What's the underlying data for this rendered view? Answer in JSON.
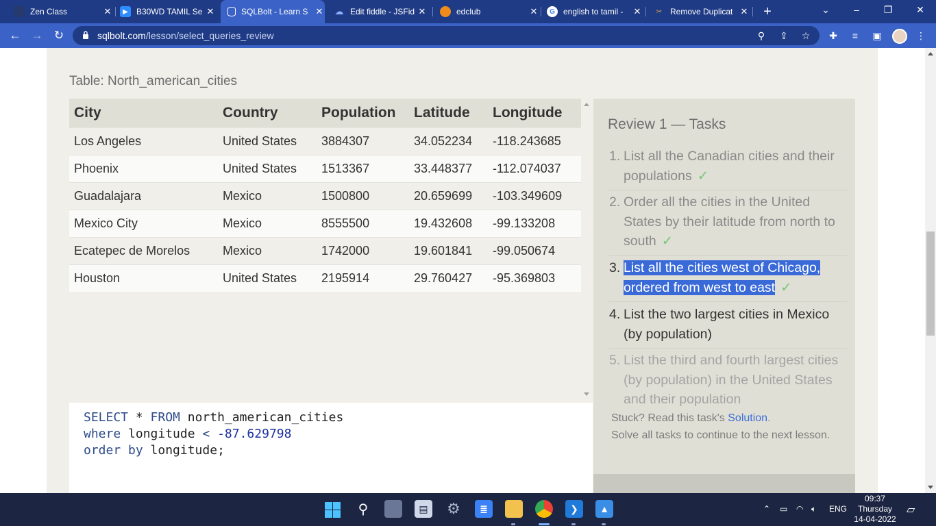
{
  "browser": {
    "tabs": [
      {
        "title": "Zen Class",
        "active": false
      },
      {
        "title": "B30WD TAMIL Se",
        "active": false
      },
      {
        "title": "SQLBolt - Learn S",
        "active": true
      },
      {
        "title": "Edit fiddle - JSFid",
        "active": false
      },
      {
        "title": "edclub",
        "active": false
      },
      {
        "title": "english to tamil -",
        "active": false
      },
      {
        "title": "Remove Duplicat",
        "active": false
      }
    ],
    "url_host": "sqlbolt.com",
    "url_path": "/lesson/select_queries_review"
  },
  "lesson": {
    "table_caption": "Table: North_american_cities",
    "columns": [
      "City",
      "Country",
      "Population",
      "Latitude",
      "Longitude"
    ],
    "rows": [
      [
        "Los Angeles",
        "United States",
        "3884307",
        "34.052234",
        "-118.243685"
      ],
      [
        "Phoenix",
        "United States",
        "1513367",
        "33.448377",
        "-112.074037"
      ],
      [
        "Guadalajara",
        "Mexico",
        "1500800",
        "20.659699",
        "-103.349609"
      ],
      [
        "Mexico City",
        "Mexico",
        "8555500",
        "19.432608",
        "-99.133208"
      ],
      [
        "Ecatepec de Morelos",
        "Mexico",
        "1742000",
        "19.601841",
        "-99.050674"
      ],
      [
        "Houston",
        "United States",
        "2195914",
        "29.760427",
        "-95.369803"
      ]
    ],
    "query": {
      "line1_kw1": "SELECT",
      "line1_star": " * ",
      "line1_kw2": "FROM",
      "line1_table": " north_american_cities",
      "line2_kw": "where",
      "line2_col": " longitude ",
      "line2_op": "<",
      "line2_val": " -87.629798",
      "line3_kw": "order by",
      "line3_col": " longitude;"
    }
  },
  "tasks": {
    "heading": "Review 1 — Tasks",
    "items": [
      {
        "num": "1.",
        "text": "List all the Canadian cities and their populations",
        "done": true
      },
      {
        "num": "2.",
        "text": "Order all the cities in the United States by their latitude from north to south",
        "done": true
      },
      {
        "num": "3.",
        "text_line1": "List all the cities west of Chicago,",
        "text_line2": "ordered from west to east",
        "done": true
      },
      {
        "num": "4.",
        "text": "List the two largest cities in Mexico (by population)",
        "done": false
      },
      {
        "num": "5.",
        "text": "List the third and fourth largest cities (by population) in the United States and their population",
        "done": false
      }
    ],
    "check_mark": "✓",
    "stuck_prefix": "Stuck? Read this task's ",
    "solution_link": "Solution",
    "stuck_suffix": ".",
    "continue_text": "Solve all tasks to continue to the next lesson."
  },
  "system": {
    "time": "09:37",
    "day": "Thursday",
    "date": "14-04-2022",
    "language": "ENG"
  },
  "colors": {
    "chrome_tab_bar": "#1f3b85",
    "chrome_toolbar": "#3b62c6",
    "page_panel": "#f0efe9",
    "tasks_panel": "#e0dfd6",
    "selection": "#3a6ad8",
    "check": "#75c775"
  }
}
